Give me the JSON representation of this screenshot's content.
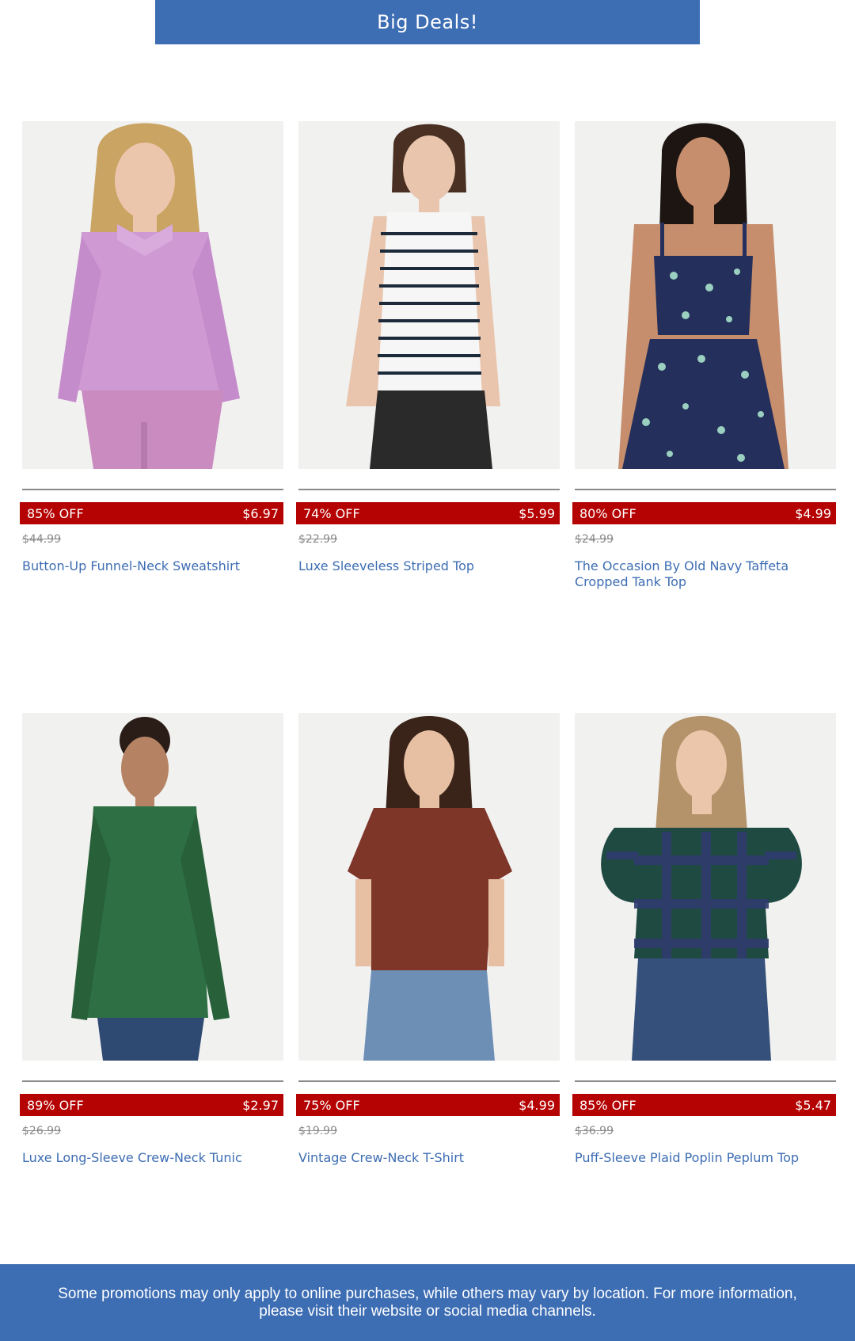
{
  "header": {
    "title": "Big Deals!"
  },
  "products": [
    {
      "discount": "85% OFF",
      "sale_price": "$6.97",
      "original_price": "$44.99",
      "name": "Button-Up Funnel-Neck Sweatshirt",
      "image_label": "model wearing pink funnel-neck sweatshirt and bike shorts",
      "colors": {
        "top": "#cf9ad3",
        "bottom": "#c98bc0",
        "hair": "#c9a462",
        "skin": "#ecc6ac"
      }
    },
    {
      "discount": "74% OFF",
      "sale_price": "$5.99",
      "original_price": "$22.99",
      "name": "Luxe Sleeveless Striped Top",
      "image_label": "model wearing striped sleeveless top and black jeans",
      "colors": {
        "top": "#f6f6f6",
        "stripe": "#1c2a3a",
        "bottom": "#2a2a2a",
        "hair": "#4a3022",
        "skin": "#e9c5ad"
      }
    },
    {
      "discount": "80% OFF",
      "sale_price": "$4.99",
      "original_price": "$24.99",
      "name": "The Occasion By Old Navy Taffeta Cropped Tank Top",
      "image_label": "model wearing navy floral cropped tank top and skirt",
      "colors": {
        "top": "#242f5c",
        "bottom": "#242f5c",
        "accent": "#9bd0c0",
        "hair": "#1d1512",
        "skin": "#c68e6c"
      }
    },
    {
      "discount": "89% OFF",
      "sale_price": "$2.97",
      "original_price": "$26.99",
      "name": "Luxe Long-Sleeve Crew-Neck Tunic",
      "image_label": "model wearing green long-sleeve tunic and jeans",
      "colors": {
        "top": "#2e7044",
        "bottom": "#2f4a72",
        "hair": "#2a1d17",
        "skin": "#b58364"
      }
    },
    {
      "discount": "75% OFF",
      "sale_price": "$4.99",
      "original_price": "$19.99",
      "name": "Vintage Crew-Neck T-Shirt",
      "image_label": "model wearing rust crew-neck t-shirt and light jeans",
      "colors": {
        "top": "#7e3628",
        "bottom": "#6e8fb5",
        "hair": "#3a2419",
        "skin": "#e7c0a3"
      }
    },
    {
      "discount": "85% OFF",
      "sale_price": "$5.47",
      "original_price": "$36.99",
      "name": "Puff-Sleeve Plaid Poplin Peplum Top",
      "image_label": "model wearing green and navy plaid puff-sleeve peplum top and jeans",
      "colors": {
        "top": "#1f4a42",
        "stripe": "#2f3b6e",
        "bottom": "#35507a",
        "hair": "#b4926a",
        "skin": "#ebc6aa"
      }
    }
  ],
  "footer": {
    "disclaimer": "Some promotions may only apply to online purchases, while others may vary by location. For more information, please visit their website or social media channels."
  }
}
